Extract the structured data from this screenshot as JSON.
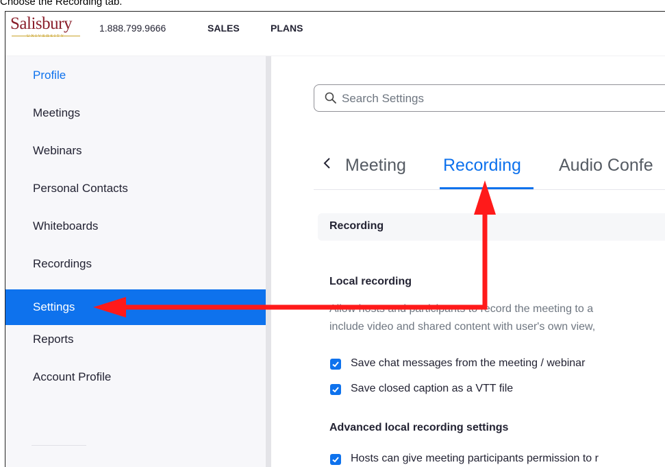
{
  "caption": "Choose the Recording tab.",
  "header": {
    "logo_text": "Salisbury",
    "logo_sub": "UNIVERSITY",
    "phone": "1.888.799.9666",
    "nav_sales": "SALES",
    "nav_plans": "PLANS"
  },
  "sidebar": {
    "items": [
      {
        "label": "Profile"
      },
      {
        "label": "Meetings"
      },
      {
        "label": "Webinars"
      },
      {
        "label": "Personal Contacts"
      },
      {
        "label": "Whiteboards"
      },
      {
        "label": "Recordings"
      },
      {
        "label": "Settings"
      },
      {
        "label": "Reports"
      },
      {
        "label": "Account Profile"
      }
    ],
    "active": "Settings"
  },
  "search": {
    "placeholder": "Search Settings"
  },
  "tabs": {
    "items": [
      {
        "label": "Meeting"
      },
      {
        "label": "Recording"
      },
      {
        "label": "Audio Confe"
      }
    ],
    "active": "Recording"
  },
  "section": {
    "title": "Recording"
  },
  "local_recording": {
    "title": "Local recording",
    "desc_line1": "Allow hosts and participants to record the meeting to a",
    "desc_line2": "include video and shared content with user's own view,",
    "checks": [
      {
        "label": "Save chat messages from the meeting / webinar",
        "checked": true
      },
      {
        "label": "Save closed caption as a VTT file",
        "checked": true
      }
    ]
  },
  "advanced": {
    "title": "Advanced local recording settings",
    "checks": [
      {
        "label": "Hosts can give meeting participants permission to r",
        "checked": true
      }
    ]
  },
  "colors": {
    "accent": "#0e72ed",
    "annotation": "#ff0000",
    "brand": "#8a1f2b"
  },
  "icons": [
    "search-icon",
    "chevron-left-icon",
    "checkbox-checked-icon",
    "red-arrow-annotation"
  ]
}
